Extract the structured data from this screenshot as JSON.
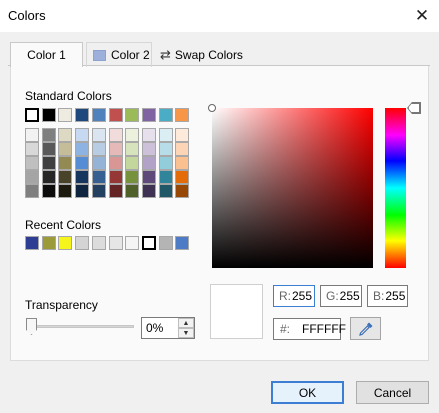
{
  "window": {
    "title": "Colors",
    "close_icon": "close-icon"
  },
  "tabs": [
    {
      "label": "Color 1",
      "active": true
    },
    {
      "label": "Color 2",
      "swatch": "#9db0dc",
      "active": false
    },
    {
      "label": "Swap Colors",
      "icon": "swap-icon",
      "active": false
    }
  ],
  "standard_colors": {
    "label": "Standard Colors",
    "top_row": [
      "#ffffff",
      "#000000",
      "#eeece1",
      "#1f497d",
      "#4f81bd",
      "#c0504d",
      "#9bbb59",
      "#8064a2",
      "#4bacc6",
      "#f79646"
    ],
    "shades": [
      [
        "#f2f2f2",
        "#7f7f7f",
        "#ddd9c3",
        "#c6d9f0",
        "#dbe5f1",
        "#f2dcdb",
        "#ebf1dd",
        "#e5e0ec",
        "#dbeef3",
        "#fdeada"
      ],
      [
        "#d8d8d8",
        "#595959",
        "#c4bd97",
        "#8db3e2",
        "#b8cce4",
        "#e5b9b7",
        "#d7e3bc",
        "#ccc1d9",
        "#b7dde8",
        "#fbd5b5"
      ],
      [
        "#bfbfbf",
        "#3f3f3f",
        "#938953",
        "#548dd4",
        "#95b3d7",
        "#d99694",
        "#c3d69b",
        "#b2a2c7",
        "#92cddc",
        "#fac08f"
      ],
      [
        "#a5a5a5",
        "#262626",
        "#494429",
        "#17365d",
        "#366092",
        "#953734",
        "#76923c",
        "#5f497a",
        "#31859b",
        "#e36c09"
      ],
      [
        "#7f7f7f",
        "#0c0c0c",
        "#1d1b10",
        "#0f243e",
        "#244061",
        "#632423",
        "#4f6128",
        "#3f3151",
        "#205867",
        "#974806"
      ]
    ]
  },
  "recent_colors": {
    "label": "Recent Colors",
    "colors": [
      "#2e3d94",
      "#9b9b3a",
      "#f5f51c",
      "#d4d4d4",
      "#dcdcdc",
      "#e6e6e6",
      "#f4f4f4",
      "#ffffff",
      "#b4b4b4",
      "#4e7bc6"
    ]
  },
  "transparency": {
    "label": "Transparency",
    "value": "0%",
    "level": 0
  },
  "rgb": {
    "r_label": "R:",
    "r_value": "255",
    "g_label": "G:",
    "g_value": "255",
    "b_label": "B:",
    "b_value": "255"
  },
  "hex": {
    "label": "#:",
    "value": "FFFFFF"
  },
  "current_color": "#ffffff",
  "buttons": {
    "ok": "OK",
    "cancel": "Cancel"
  }
}
